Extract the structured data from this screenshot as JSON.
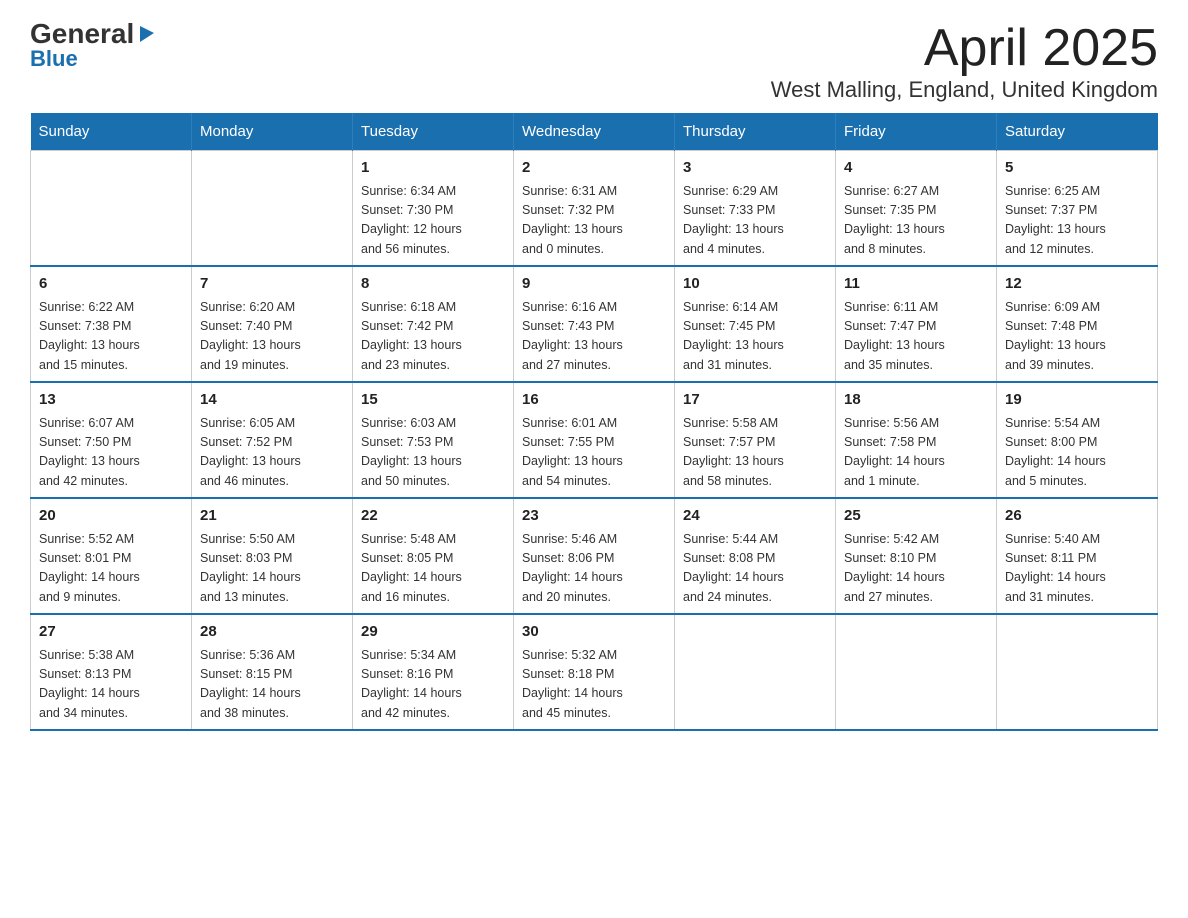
{
  "logo": {
    "part1": "General",
    "triangle": "▶",
    "part2": "Blue"
  },
  "title": "April 2025",
  "location": "West Malling, England, United Kingdom",
  "days_of_week": [
    "Sunday",
    "Monday",
    "Tuesday",
    "Wednesday",
    "Thursday",
    "Friday",
    "Saturday"
  ],
  "weeks": [
    [
      {
        "day": "",
        "info": ""
      },
      {
        "day": "",
        "info": ""
      },
      {
        "day": "1",
        "info": "Sunrise: 6:34 AM\nSunset: 7:30 PM\nDaylight: 12 hours\nand 56 minutes."
      },
      {
        "day": "2",
        "info": "Sunrise: 6:31 AM\nSunset: 7:32 PM\nDaylight: 13 hours\nand 0 minutes."
      },
      {
        "day": "3",
        "info": "Sunrise: 6:29 AM\nSunset: 7:33 PM\nDaylight: 13 hours\nand 4 minutes."
      },
      {
        "day": "4",
        "info": "Sunrise: 6:27 AM\nSunset: 7:35 PM\nDaylight: 13 hours\nand 8 minutes."
      },
      {
        "day": "5",
        "info": "Sunrise: 6:25 AM\nSunset: 7:37 PM\nDaylight: 13 hours\nand 12 minutes."
      }
    ],
    [
      {
        "day": "6",
        "info": "Sunrise: 6:22 AM\nSunset: 7:38 PM\nDaylight: 13 hours\nand 15 minutes."
      },
      {
        "day": "7",
        "info": "Sunrise: 6:20 AM\nSunset: 7:40 PM\nDaylight: 13 hours\nand 19 minutes."
      },
      {
        "day": "8",
        "info": "Sunrise: 6:18 AM\nSunset: 7:42 PM\nDaylight: 13 hours\nand 23 minutes."
      },
      {
        "day": "9",
        "info": "Sunrise: 6:16 AM\nSunset: 7:43 PM\nDaylight: 13 hours\nand 27 minutes."
      },
      {
        "day": "10",
        "info": "Sunrise: 6:14 AM\nSunset: 7:45 PM\nDaylight: 13 hours\nand 31 minutes."
      },
      {
        "day": "11",
        "info": "Sunrise: 6:11 AM\nSunset: 7:47 PM\nDaylight: 13 hours\nand 35 minutes."
      },
      {
        "day": "12",
        "info": "Sunrise: 6:09 AM\nSunset: 7:48 PM\nDaylight: 13 hours\nand 39 minutes."
      }
    ],
    [
      {
        "day": "13",
        "info": "Sunrise: 6:07 AM\nSunset: 7:50 PM\nDaylight: 13 hours\nand 42 minutes."
      },
      {
        "day": "14",
        "info": "Sunrise: 6:05 AM\nSunset: 7:52 PM\nDaylight: 13 hours\nand 46 minutes."
      },
      {
        "day": "15",
        "info": "Sunrise: 6:03 AM\nSunset: 7:53 PM\nDaylight: 13 hours\nand 50 minutes."
      },
      {
        "day": "16",
        "info": "Sunrise: 6:01 AM\nSunset: 7:55 PM\nDaylight: 13 hours\nand 54 minutes."
      },
      {
        "day": "17",
        "info": "Sunrise: 5:58 AM\nSunset: 7:57 PM\nDaylight: 13 hours\nand 58 minutes."
      },
      {
        "day": "18",
        "info": "Sunrise: 5:56 AM\nSunset: 7:58 PM\nDaylight: 14 hours\nand 1 minute."
      },
      {
        "day": "19",
        "info": "Sunrise: 5:54 AM\nSunset: 8:00 PM\nDaylight: 14 hours\nand 5 minutes."
      }
    ],
    [
      {
        "day": "20",
        "info": "Sunrise: 5:52 AM\nSunset: 8:01 PM\nDaylight: 14 hours\nand 9 minutes."
      },
      {
        "day": "21",
        "info": "Sunrise: 5:50 AM\nSunset: 8:03 PM\nDaylight: 14 hours\nand 13 minutes."
      },
      {
        "day": "22",
        "info": "Sunrise: 5:48 AM\nSunset: 8:05 PM\nDaylight: 14 hours\nand 16 minutes."
      },
      {
        "day": "23",
        "info": "Sunrise: 5:46 AM\nSunset: 8:06 PM\nDaylight: 14 hours\nand 20 minutes."
      },
      {
        "day": "24",
        "info": "Sunrise: 5:44 AM\nSunset: 8:08 PM\nDaylight: 14 hours\nand 24 minutes."
      },
      {
        "day": "25",
        "info": "Sunrise: 5:42 AM\nSunset: 8:10 PM\nDaylight: 14 hours\nand 27 minutes."
      },
      {
        "day": "26",
        "info": "Sunrise: 5:40 AM\nSunset: 8:11 PM\nDaylight: 14 hours\nand 31 minutes."
      }
    ],
    [
      {
        "day": "27",
        "info": "Sunrise: 5:38 AM\nSunset: 8:13 PM\nDaylight: 14 hours\nand 34 minutes."
      },
      {
        "day": "28",
        "info": "Sunrise: 5:36 AM\nSunset: 8:15 PM\nDaylight: 14 hours\nand 38 minutes."
      },
      {
        "day": "29",
        "info": "Sunrise: 5:34 AM\nSunset: 8:16 PM\nDaylight: 14 hours\nand 42 minutes."
      },
      {
        "day": "30",
        "info": "Sunrise: 5:32 AM\nSunset: 8:18 PM\nDaylight: 14 hours\nand 45 minutes."
      },
      {
        "day": "",
        "info": ""
      },
      {
        "day": "",
        "info": ""
      },
      {
        "day": "",
        "info": ""
      }
    ]
  ]
}
